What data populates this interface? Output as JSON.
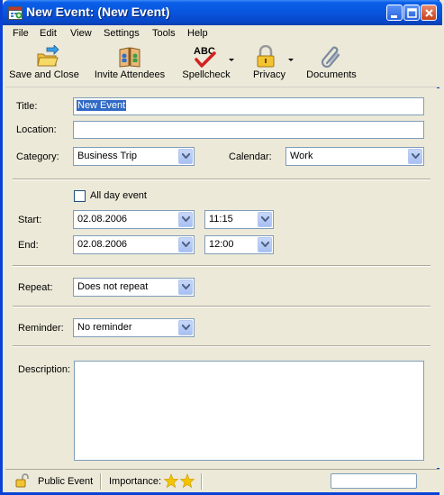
{
  "window": {
    "title": "New Event: (New Event)"
  },
  "menu": {
    "items": [
      "File",
      "Edit",
      "View",
      "Settings",
      "Tools",
      "Help"
    ]
  },
  "toolbar": {
    "save_close": "Save and Close",
    "invite": "Invite Attendees",
    "spellcheck": "Spellcheck",
    "privacy": "Privacy",
    "documents": "Documents"
  },
  "form": {
    "title_label": "Title:",
    "title_value": "New Event",
    "location_label": "Location:",
    "location_value": "",
    "category_label": "Category:",
    "category_value": "Business Trip",
    "calendar_label": "Calendar:",
    "calendar_value": "Work",
    "all_day_label": "All day event",
    "all_day_checked": false,
    "start_label": "Start:",
    "start_date": "02.08.2006",
    "start_time": "11:15",
    "end_label": "End:",
    "end_date": "02.08.2006",
    "end_time": "12:00",
    "repeat_label": "Repeat:",
    "repeat_value": "Does not repeat",
    "reminder_label": "Reminder:",
    "reminder_value": "No reminder",
    "description_label": "Description:",
    "description_value": ""
  },
  "status": {
    "privacy": "Public Event",
    "importance_label": "Importance:",
    "importance_stars": 2
  },
  "colors": {
    "titlebar": "#0855dd",
    "selection": "#316ac5",
    "field_border": "#7f9db9",
    "star": "#f5c400"
  },
  "icons": [
    "new-event-icon",
    "minimize-icon",
    "maximize-icon",
    "close-icon",
    "save-close-icon",
    "invite-attendees-icon",
    "spellcheck-icon",
    "privacy-lock-icon",
    "documents-paperclip-icon",
    "dropdown-arrow-icon",
    "public-lock-icon",
    "star-icon"
  ]
}
